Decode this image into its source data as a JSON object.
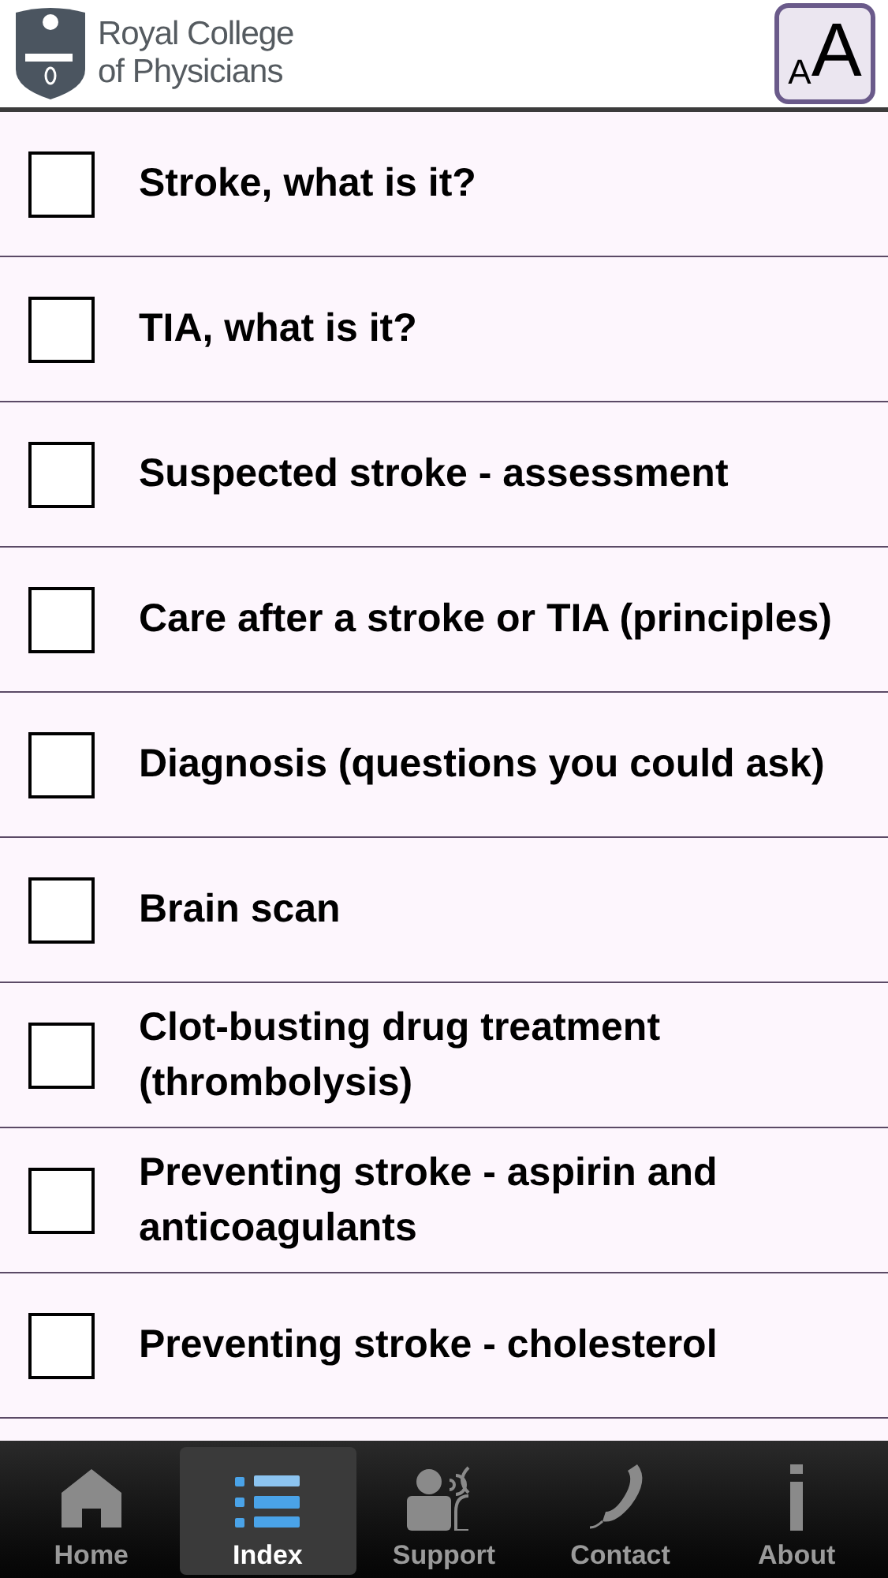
{
  "header": {
    "logo_lines": [
      "Royal College",
      "of Physicians"
    ],
    "font_button": {
      "small": "A",
      "large": "A"
    }
  },
  "items": [
    {
      "label": "Stroke, what is it?",
      "checked": false
    },
    {
      "label": "TIA, what is it?",
      "checked": false
    },
    {
      "label": "Suspected stroke - assessment",
      "checked": false
    },
    {
      "label": "Care after a stroke or TIA (principles)",
      "checked": false
    },
    {
      "label": "Diagnosis (questions you could ask)",
      "checked": false
    },
    {
      "label": "Brain scan",
      "checked": false
    },
    {
      "label": "Clot-busting drug treatment (thrombolysis)",
      "checked": false
    },
    {
      "label": "Preventing stroke - aspirin and anticoagulants",
      "checked": false
    },
    {
      "label": "Preventing stroke - cholesterol",
      "checked": false
    }
  ],
  "tab_bar": [
    {
      "label": "Home",
      "kind": "home",
      "selected": false
    },
    {
      "label": "Index",
      "kind": "index",
      "selected": true
    },
    {
      "label": "Support",
      "kind": "support",
      "selected": false
    },
    {
      "label": "Contact",
      "kind": "contact",
      "selected": false
    },
    {
      "label": "About",
      "kind": "about",
      "selected": false
    }
  ]
}
